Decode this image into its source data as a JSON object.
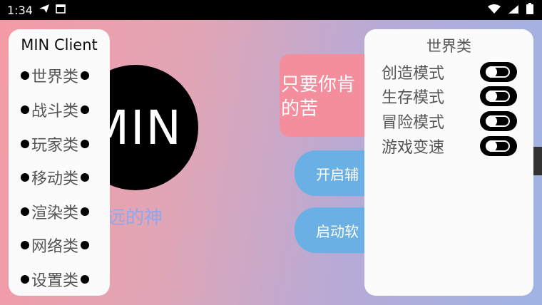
{
  "status_bar": {
    "time": "1:34",
    "icons": [
      "bird-app-icon",
      "calendar-icon",
      "wifi-icon",
      "signal-icon",
      "battery-icon"
    ]
  },
  "background": {
    "logo_text": "MIN",
    "subtitle": "远的神",
    "motto": [
      "只要你肯",
      "的苦"
    ],
    "button_start_assist": "开启辅",
    "button_launch": "启动软"
  },
  "left_menu": {
    "title": "MIN Client",
    "items": [
      "世界类",
      "战斗类",
      "玩家类",
      "移动类",
      "渲染类",
      "网络类",
      "设置类"
    ]
  },
  "right_panel": {
    "title": "世界类",
    "options": [
      {
        "label": "创造模式",
        "on": false
      },
      {
        "label": "生存模式",
        "on": false
      },
      {
        "label": "冒险模式",
        "on": false
      },
      {
        "label": "游戏变速",
        "on": false
      }
    ]
  },
  "colors": {
    "accent_pink": "#f48e9c",
    "accent_blue": "#6ab0e4",
    "panel": "#fbfbfb"
  }
}
